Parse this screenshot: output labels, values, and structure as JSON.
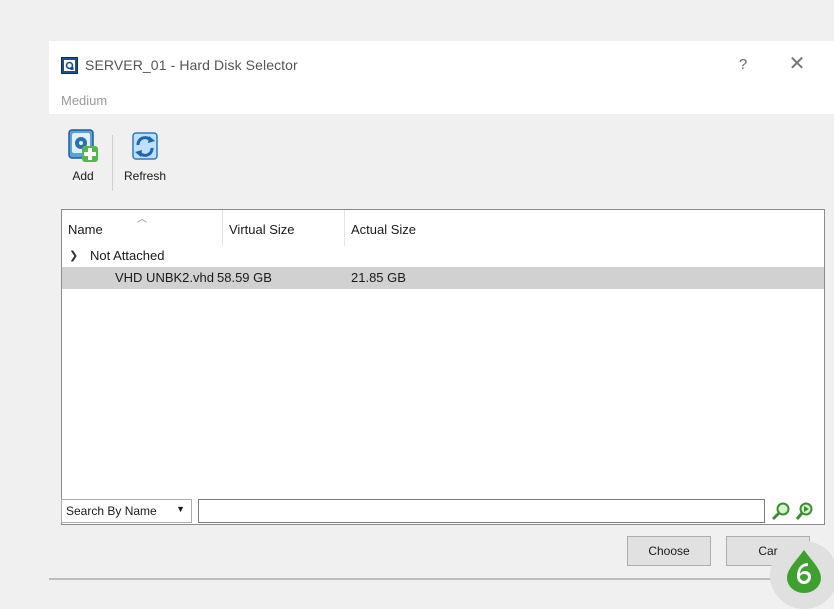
{
  "window": {
    "title": "SERVER_01 - Hard Disk Selector",
    "help_label": "?",
    "close_label": "✕"
  },
  "menu": {
    "medium": "Medium"
  },
  "toolbar": {
    "add_label": "Add",
    "refresh_label": "Refresh"
  },
  "table": {
    "columns": [
      "Name",
      "Virtual Size",
      "Actual Size"
    ],
    "groups": [
      {
        "label": "Not Attached",
        "rows": [
          {
            "name": "VHD UNBK2.vhd",
            "virtual_size": "58.59 GB",
            "actual_size": "21.85 GB"
          }
        ]
      }
    ]
  },
  "search": {
    "mode_label": "Search By Name",
    "value": ""
  },
  "buttons": {
    "choose": "Choose",
    "cancel": "Car"
  },
  "colors": {
    "selected_row": "#d1d1d1",
    "badge_green": "#3ea12f"
  }
}
